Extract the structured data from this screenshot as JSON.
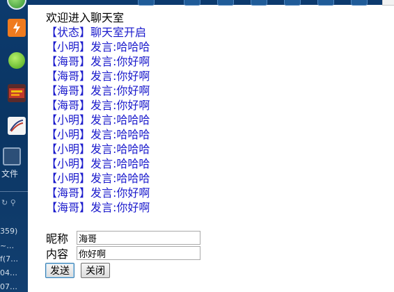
{
  "sidebar": {
    "file_label": "文件",
    "fragments": [
      "359)",
      "~…",
      "f(7…",
      "04…",
      "07…"
    ]
  },
  "chat": {
    "welcome": "欢迎进入聊天室",
    "messages": [
      "【状态】聊天室开启",
      "【小明】发言:哈哈哈",
      "【海哥】发言:你好啊",
      "【海哥】发言:你好啊",
      "【海哥】发言:你好啊",
      "【海哥】发言:你好啊",
      "【小明】发言:哈哈哈",
      "【小明】发言:哈哈哈",
      "【小明】发言:哈哈哈",
      "【小明】发言:哈哈哈",
      "【小明】发言:哈哈哈",
      "【海哥】发言:你好啊",
      "【海哥】发言:你好啊"
    ]
  },
  "form": {
    "nickname_label": "昵称",
    "nickname_value": "海哥",
    "content_label": "内容",
    "content_value": "你好啊"
  },
  "buttons": {
    "send_label": "发送",
    "close_label": "关闭"
  },
  "colors": {
    "message_text": "#1a1acc",
    "taskbar": "#0d3b6e"
  }
}
